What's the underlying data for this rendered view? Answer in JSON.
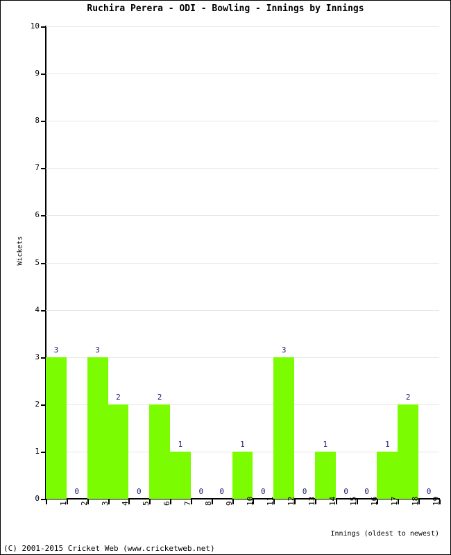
{
  "chart_data": {
    "type": "bar",
    "title": "Ruchira Perera - ODI - Bowling - Innings by Innings",
    "xlabel": "Innings (oldest to newest)",
    "ylabel": "Wickets",
    "categories": [
      "1",
      "2",
      "3",
      "4",
      "5",
      "6",
      "7",
      "8",
      "9",
      "10",
      "11",
      "12",
      "13",
      "14",
      "15",
      "16",
      "17",
      "18",
      "19"
    ],
    "values": [
      3,
      0,
      3,
      2,
      0,
      2,
      1,
      0,
      0,
      1,
      0,
      3,
      0,
      1,
      0,
      0,
      1,
      2,
      0
    ],
    "data_labels": [
      "3",
      "0",
      "3",
      "2",
      "0",
      "2",
      "1",
      "0",
      "0",
      "1",
      "0",
      "3",
      "0",
      "1",
      "0",
      "0",
      "1",
      "2",
      "0"
    ],
    "ylim": [
      0,
      10
    ],
    "ytick_labels": [
      "0",
      "1",
      "2",
      "3",
      "4",
      "5",
      "6",
      "7",
      "8",
      "9",
      "10"
    ],
    "ytick_values": [
      0,
      1,
      2,
      3,
      4,
      5,
      6,
      7,
      8,
      9,
      10
    ],
    "grid": true,
    "grid_axis": "y",
    "legend": false,
    "bar_color": "#7CFC00",
    "label_color": "#191970",
    "grid_color": "#E6E6E6",
    "axis_color": "#000000"
  },
  "footer": {
    "copyright": "(C) 2001-2015 Cricket Web (www.cricketweb.net)"
  }
}
